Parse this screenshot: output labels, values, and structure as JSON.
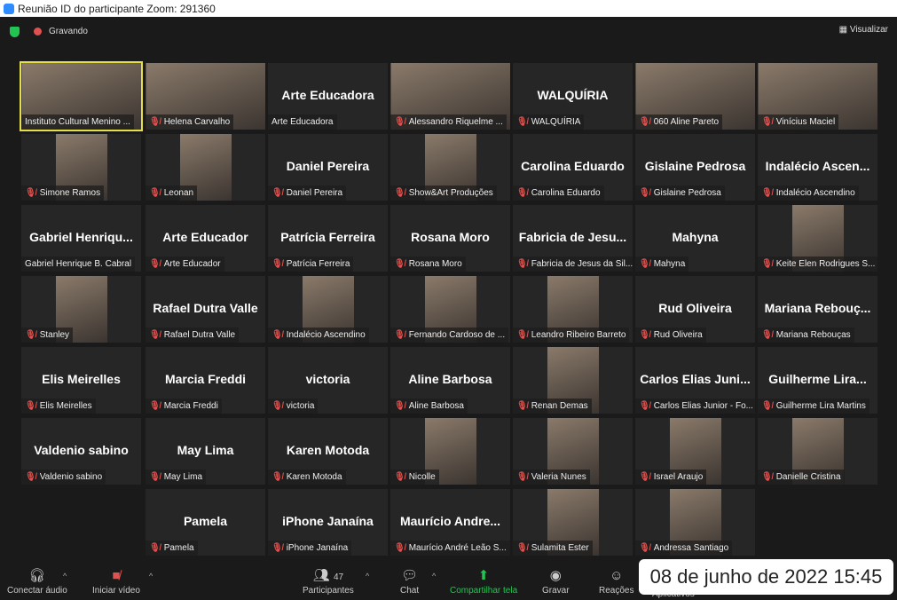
{
  "window_title": "Reunião ID do participante Zoom: 291360",
  "topbar": {
    "recording": "Gravando",
    "view": "Visualizar"
  },
  "tiles": [
    {
      "label": "Instituto Cultural Menino ...",
      "video": true,
      "muted": false,
      "active": true
    },
    {
      "label": "Helena Carvalho",
      "video": true,
      "muted": true
    },
    {
      "big": "Arte Educadora",
      "label": "Arte Educadora",
      "muted": false
    },
    {
      "label": "Alessandro Riquelme ...",
      "video": true,
      "muted": true
    },
    {
      "big": "WALQUÍRIA",
      "label": "WALQUÍRIA",
      "muted": true
    },
    {
      "label": "060 Aline Pareto",
      "video": true,
      "muted": true
    },
    {
      "label": "Vinícius Maciel",
      "video": true,
      "muted": true
    },
    {
      "label": "Simone Ramos",
      "video": true,
      "muted": true
    },
    {
      "label": "Leonan",
      "video": true,
      "muted": true
    },
    {
      "big": "Daniel Pereira",
      "label": "Daniel Pereira",
      "muted": true
    },
    {
      "label": "Show&Art Produções",
      "video": true,
      "muted": true
    },
    {
      "big": "Carolina Eduardo",
      "label": "Carolina Eduardo",
      "muted": true
    },
    {
      "big": "Gislaine Pedrosa",
      "label": "Gislaine Pedrosa",
      "muted": true
    },
    {
      "big": "Indalécio Ascen...",
      "label": "Indalécio Ascendino",
      "muted": true
    },
    {
      "big": "Gabriel Henriqu...",
      "label": "Gabriel Henrique B. Cabral",
      "muted": false
    },
    {
      "big": "Arte Educador",
      "label": "Arte Educador",
      "muted": true
    },
    {
      "big": "Patrícia Ferreira",
      "label": "Patrícia Ferreira",
      "muted": true
    },
    {
      "big": "Rosana Moro",
      "label": "Rosana Moro",
      "muted": true
    },
    {
      "big": "Fabricia de Jesu...",
      "label": "Fabricia de Jesus da Sil...",
      "muted": true
    },
    {
      "big": "Mahyna",
      "label": "Mahyna",
      "muted": true
    },
    {
      "label": "Keite Elen Rodrigues S...",
      "video": true,
      "muted": true
    },
    {
      "label": "Stanley",
      "video": true,
      "muted": true
    },
    {
      "big": "Rafael Dutra Valle",
      "label": "Rafael Dutra Valle",
      "muted": true
    },
    {
      "label": "Indalécio Ascendino",
      "video": true,
      "muted": true
    },
    {
      "label": "Fernando Cardoso de ...",
      "video": true,
      "muted": true
    },
    {
      "label": "Leandro Ribeiro Barreto",
      "video": true,
      "muted": true
    },
    {
      "big": "Rud Oliveira",
      "label": "Rud Oliveira",
      "muted": true
    },
    {
      "big": "Mariana Rebouç...",
      "label": "Mariana Rebouças",
      "muted": true
    },
    {
      "big": "Elis Meirelles",
      "label": "Elis Meirelles",
      "muted": true
    },
    {
      "big": "Marcia Freddi",
      "label": "Marcia Freddi",
      "muted": true
    },
    {
      "big": "victoria",
      "label": "victoria",
      "muted": true
    },
    {
      "big": "Aline Barbosa",
      "label": "Aline Barbosa",
      "muted": true
    },
    {
      "label": "Renan Demas",
      "video": true,
      "muted": true
    },
    {
      "big": "Carlos Elias Juni...",
      "label": "Carlos Elias Junior - Fo...",
      "muted": true
    },
    {
      "big": "Guilherme Lira...",
      "label": "Guilherme Lira Martins",
      "muted": true
    },
    {
      "big": "Valdenio sabino",
      "label": "Valdenio sabino",
      "muted": true
    },
    {
      "big": "May Lima",
      "label": "May Lima",
      "muted": true
    },
    {
      "big": "Karen Motoda",
      "label": "Karen Motoda",
      "muted": true
    },
    {
      "label": "Nicolle",
      "video": true,
      "muted": true
    },
    {
      "label": "Valeria Nunes",
      "video": true,
      "muted": true
    },
    {
      "label": "Israel Araujo",
      "video": true,
      "muted": true
    },
    {
      "label": "Danielle Cristina",
      "video": true,
      "muted": true
    },
    null,
    {
      "big": "Pamela",
      "label": "Pamela",
      "muted": true
    },
    {
      "big": "iPhone Janaína",
      "label": "iPhone Janaína",
      "muted": true
    },
    {
      "big": "Maurício Andre...",
      "label": "Maurício André Leão S...",
      "muted": true
    },
    {
      "label": "Sulamita Ester",
      "video": true,
      "muted": true
    },
    {
      "label": "Andressa Santiago",
      "video": true,
      "muted": true
    }
  ],
  "toolbar": {
    "audio": "Conectar áudio",
    "video": "Iniciar vídeo",
    "participants": "Participantes",
    "participants_count": "47",
    "chat": "Chat",
    "share": "Compartilhar tela",
    "record": "Gravar",
    "reactions": "Reações",
    "apps": "Aplicativos"
  },
  "timestamp": "08 de junho de 2022 15:45",
  "colors": {
    "active_speaker": "#e5e04a",
    "muted": "#e0524f",
    "share": "#23c552"
  }
}
